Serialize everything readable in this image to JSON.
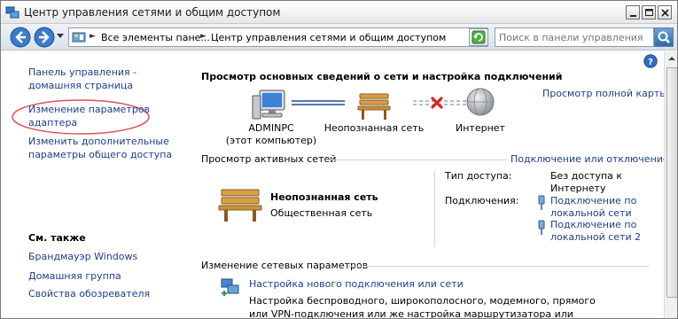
{
  "window": {
    "title": "Центр управления сетями и общим доступом"
  },
  "nav": {
    "breadcrumbs": [
      "Все элементы пане...",
      "Центр управления сетями и общим доступом"
    ],
    "search_placeholder": "Поиск в панели управления"
  },
  "left": {
    "links": [
      "Панель управления - домашняя страница",
      "Изменение параметров адаптера",
      "Изменить дополнительные параметры общего доступа"
    ],
    "see_also_title": "См. также",
    "see_also": [
      "Брандмауэр Windows",
      "Домашняя группа",
      "Свойства обозревателя"
    ]
  },
  "main": {
    "heading": "Просмотр основных сведений о сети и настройка подключений",
    "full_map_link": "Просмотр полной карты",
    "map": {
      "computer_name": "ADMINPC",
      "computer_sub": "(этот компьютер)",
      "network": "Неопознанная сеть",
      "internet": "Интернет"
    },
    "active_title": "Просмотр активных сетей",
    "connect_link": "Подключение или отключение",
    "active_network": {
      "name": "Неопознанная сеть",
      "type": "Общественная сеть",
      "access_label": "Тип доступа:",
      "access_value": "Без доступа к Интернету",
      "connections_label": "Подключения:",
      "connections": [
        "Подключение по локальной сети",
        "Подключение по локальной сети 2"
      ]
    },
    "change_title": "Изменение сетевых параметров",
    "new_conn_link": "Настройка нового подключения или сети",
    "new_conn_desc": "Настройка беспроводного, широкополосного, модемного, прямого или VPN-подключения или же настройка маршрутизатора или точки доступа."
  },
  "colors": {
    "link": "#1f3c88",
    "annotation": "#e0505a"
  },
  "icons": [
    "network-center-icon",
    "back-icon",
    "forward-icon",
    "refresh-icon",
    "search-icon",
    "help-icon",
    "computer-icon",
    "bench-icon",
    "globe-icon",
    "error-x-icon",
    "adapter-icon",
    "new-connection-icon"
  ]
}
